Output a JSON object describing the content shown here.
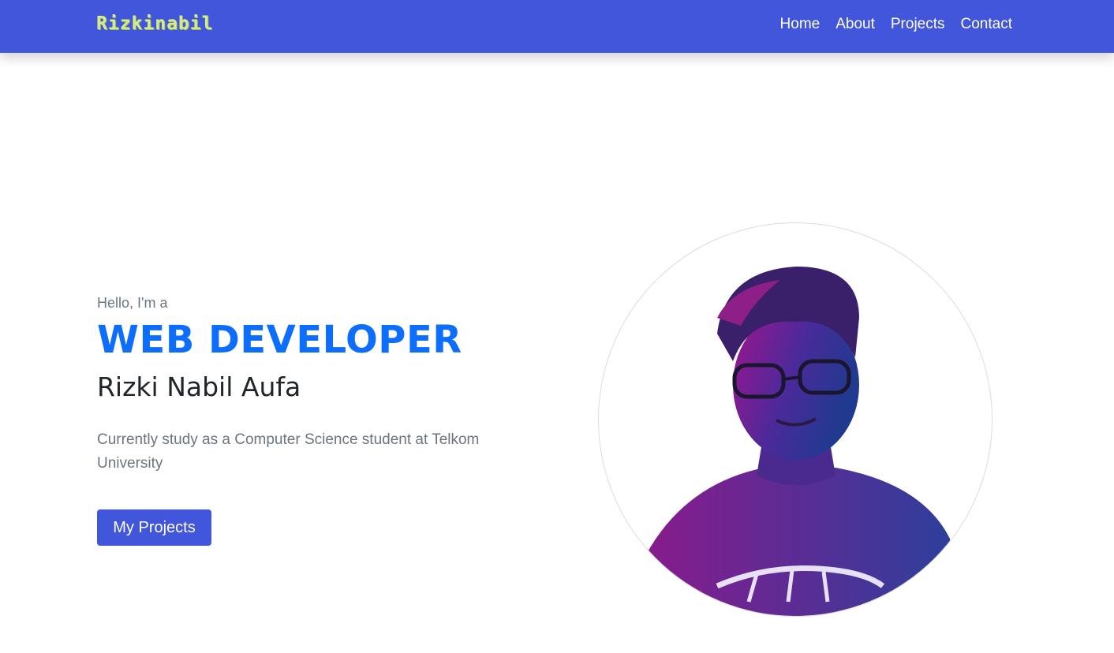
{
  "navbar": {
    "brand": "Rizkinabil",
    "links": [
      "Home",
      "About",
      "Projects",
      "Contact"
    ]
  },
  "hero": {
    "greeting": "Hello, I'm a",
    "role": "WEB DEVELOPER",
    "name": "Rizki Nabil Aufa",
    "description": "Currently study as a Computer Science student at Telkom University",
    "button_label": "My Projects"
  },
  "colors": {
    "navbar_bg": "#4156db",
    "brand": "#d4ec8c",
    "role": "#0d6efd",
    "button_bg": "#4156db"
  }
}
